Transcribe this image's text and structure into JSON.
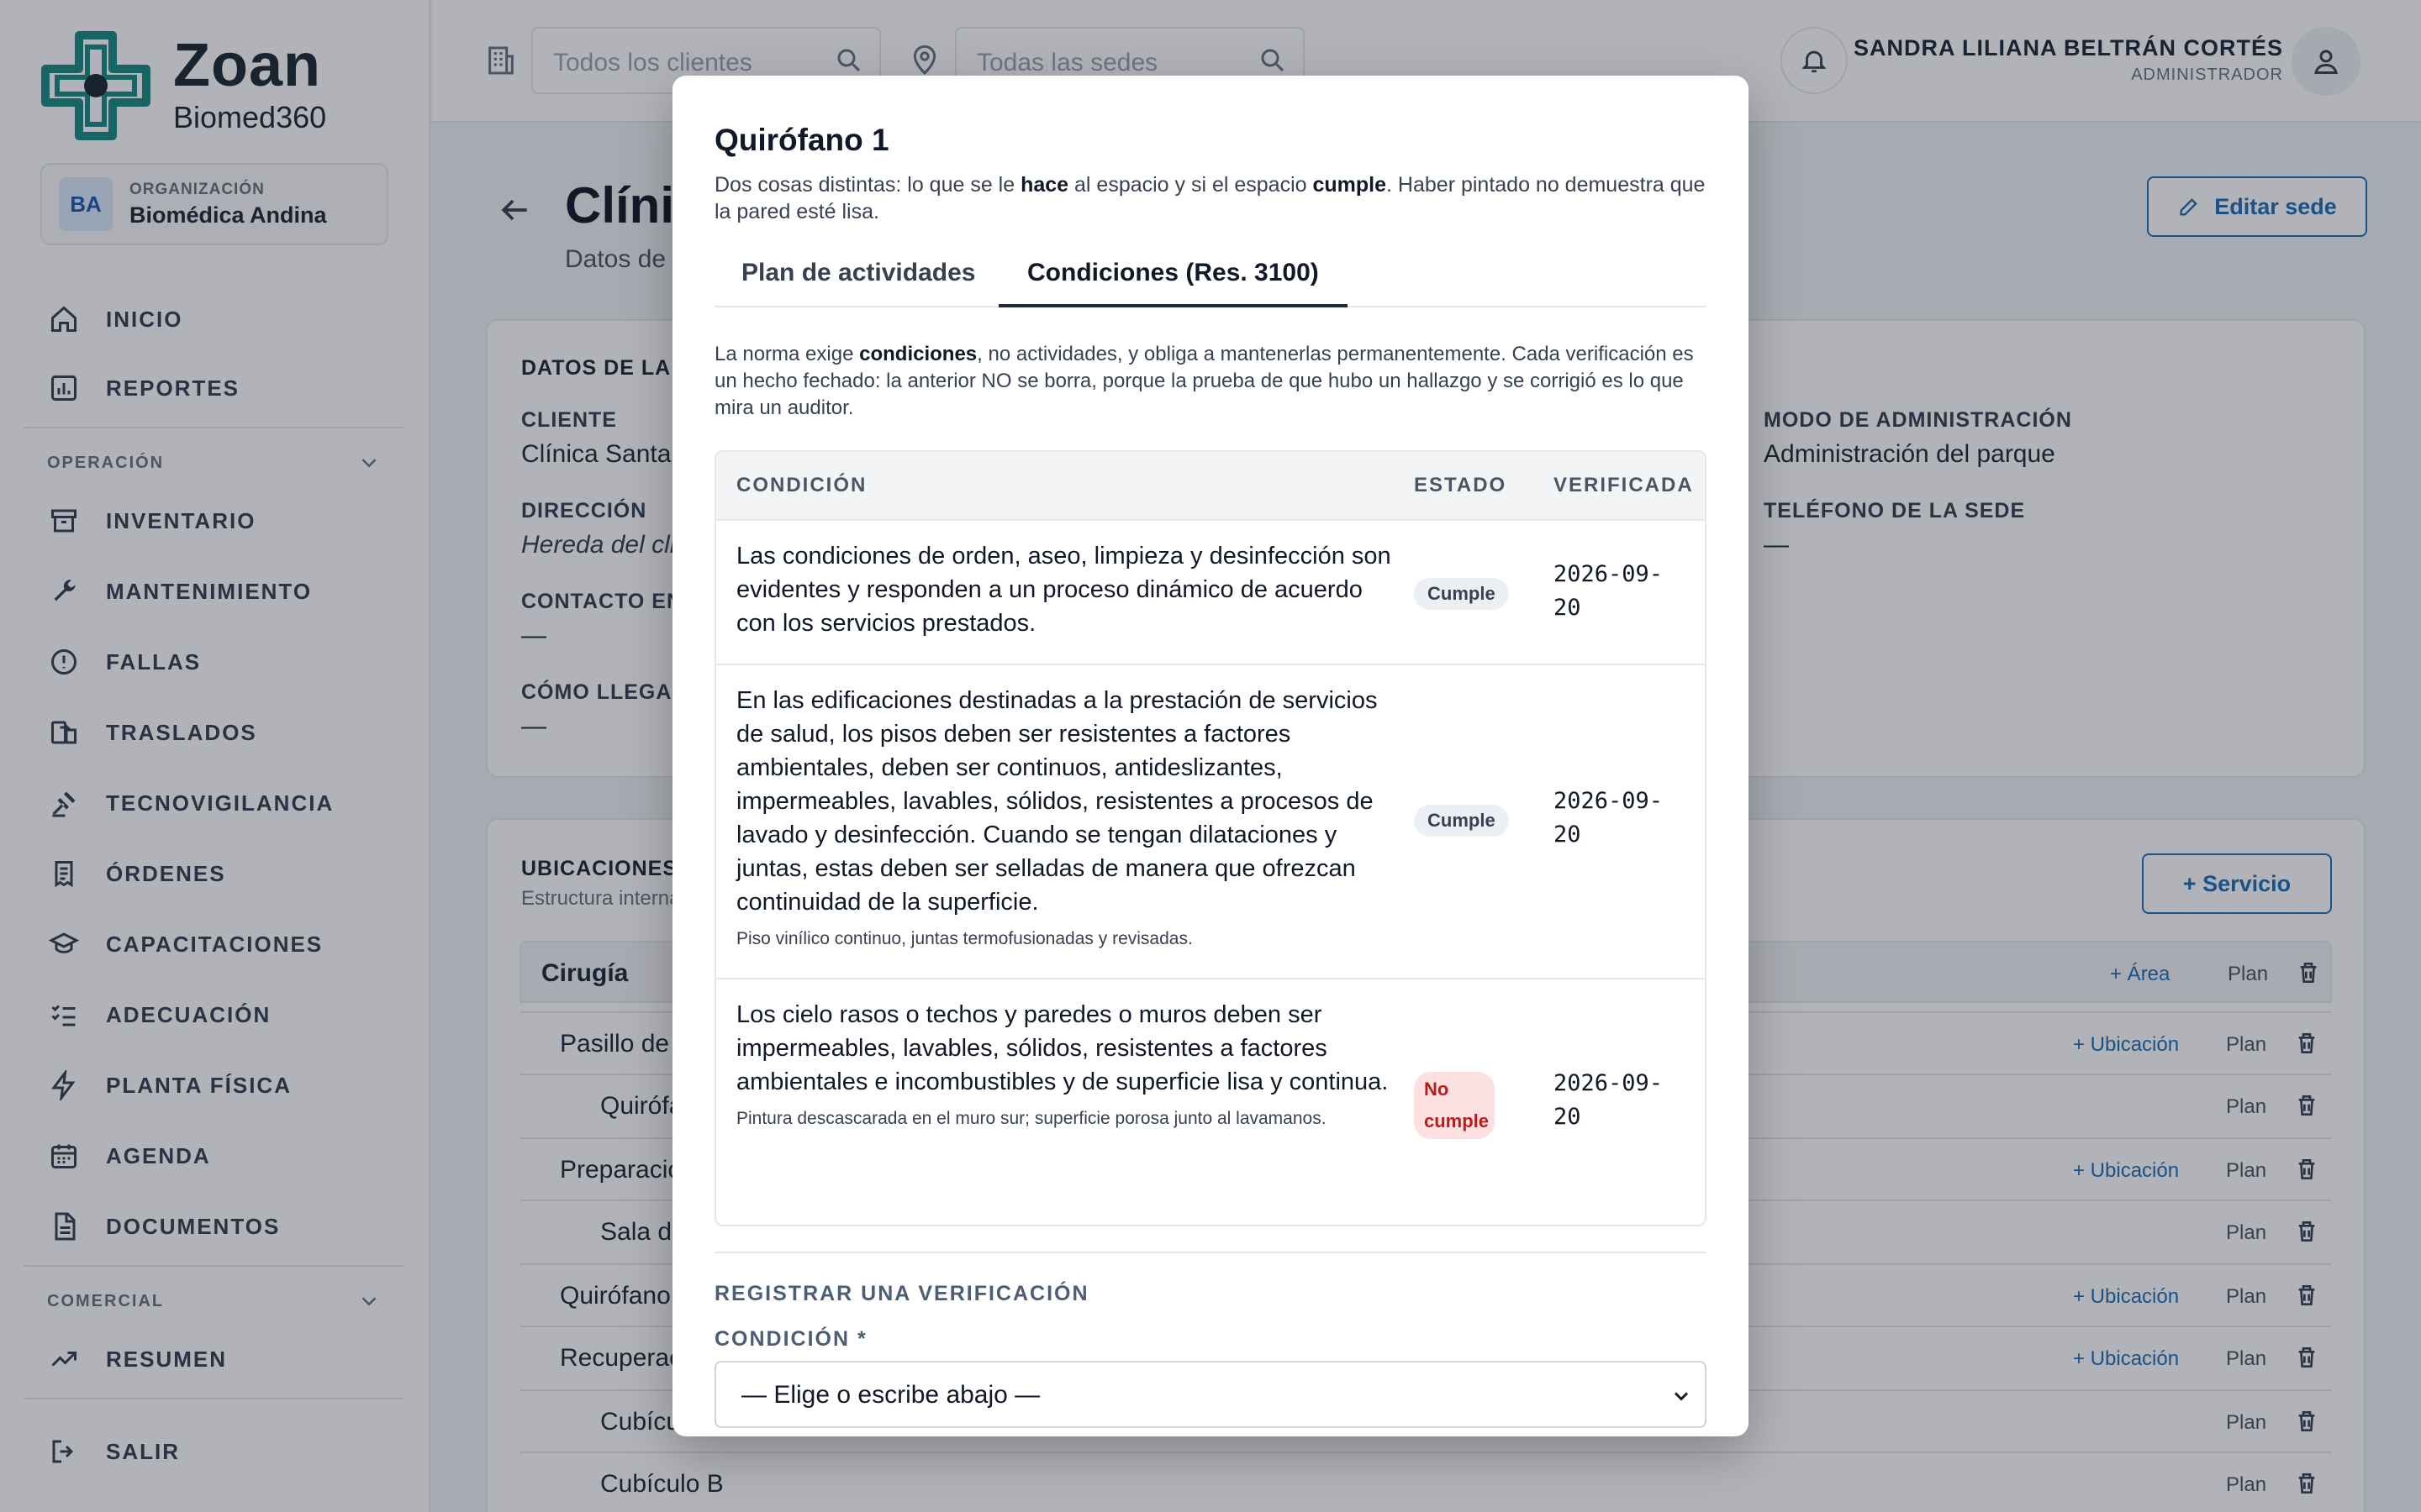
{
  "brand": {
    "name": "Zoan",
    "sub": "Biomed360"
  },
  "org": {
    "label": "ORGANIZACIÓN",
    "name": "Biomédica Andina",
    "initials": "BA"
  },
  "nav": {
    "inicio": "INICIO",
    "reportes": "REPORTES",
    "section_operacion": "OPERACIÓN",
    "inventario": "INVENTARIO",
    "mantenimiento": "MANTENIMIENTO",
    "fallas": "FALLAS",
    "traslados": "TRASLADOS",
    "tecnovigilancia": "TECNOVIGILANCIA",
    "ordenes": "ÓRDENES",
    "capacitaciones": "CAPACITACIONES",
    "adecuacion": "ADECUACIÓN",
    "planta": "PLANTA FÍSICA",
    "agenda": "AGENDA",
    "documentos": "DOCUMENTOS",
    "section_comercial": "COMERCIAL",
    "resumen": "RESUMEN",
    "salir": "SALIR"
  },
  "topbar": {
    "clients_placeholder": "Todos los clientes",
    "sites_placeholder": "Todas las sedes",
    "user_name": "SANDRA LILIANA BELTRÁN CORTÉS",
    "user_role": "ADMINISTRADOR"
  },
  "page": {
    "title": "Clínic",
    "subtitle": "Datos de l",
    "edit_button": "Editar sede",
    "data_card_title": "DATOS DE LA S",
    "cliente_label": "CLIENTE",
    "cliente_value": "Clínica Santa",
    "direccion_label": "DIRECCIÓN",
    "direccion_value": "Hereda del cli",
    "contacto_label": "CONTACTO EN",
    "contacto_value": "—",
    "como_label": "CÓMO LLEGAR",
    "como_value": "—",
    "modo_label": "MODO DE ADMINISTRACIÓN",
    "modo_value": "Administración del parque",
    "telefono_label": "TELÉFONO DE LA SEDE",
    "telefono_value": "—",
    "ubicaciones_title": "UBICACIONES",
    "ubicaciones_sub": "Estructura interna",
    "servicio_button": "+ Servicio"
  },
  "locations": [
    {
      "name": "Cirugía",
      "add": "+ Área",
      "plan": "Plan"
    },
    {
      "name": "Pasillo de",
      "add": "+ Ubicación",
      "plan": "Plan"
    },
    {
      "name": "Quirófa",
      "add": "",
      "plan": "Plan"
    },
    {
      "name": "Preparació",
      "add": "+ Ubicación",
      "plan": "Plan"
    },
    {
      "name": "Sala de",
      "add": "",
      "plan": "Plan"
    },
    {
      "name": "Quirófano",
      "add": "+ Ubicación",
      "plan": "Plan"
    },
    {
      "name": "Recuperac",
      "add": "+ Ubicación",
      "plan": "Plan"
    },
    {
      "name": "Cubícu",
      "add": "",
      "plan": "Plan"
    },
    {
      "name": "Cubículo B",
      "add": "",
      "plan": "Plan"
    }
  ],
  "modal": {
    "title": "Quirófano 1",
    "desc_1": "Dos cosas distintas: lo que se le ",
    "desc_b1": "hace",
    "desc_2": " al espacio y si el espacio ",
    "desc_b2": "cumple",
    "desc_3": ". Haber pintado no demuestra que la pared esté lisa.",
    "tab_plan": "Plan de actividades",
    "tab_conditions": "Condiciones (Res. 3100)",
    "note_1": "La norma exige ",
    "note_b": "condiciones",
    "note_2": ", no actividades, y obliga a mantenerlas permanentemente. Cada verificación es un hecho fechado: la anterior NO se borra, porque la prueba de que hubo un hallazgo y se corrigió es lo que mira un auditor.",
    "th_condition": "CONDICIÓN",
    "th_status": "ESTADO",
    "th_verified": "VERIFICADA",
    "rows": [
      {
        "condition": "Las condiciones de orden, aseo, limpieza y desinfección son evidentes y responden a un proceso dinámico de acuerdo con los servicios prestados.",
        "note": "",
        "status": "Cumple",
        "date": "2026-09-20"
      },
      {
        "condition": "En las edificaciones destinadas a la prestación de servicios de salud, los pisos deben ser resistentes a factores ambientales, deben ser continuos, antideslizantes, impermeables, lavables, sólidos, resistentes a procesos de lavado y desinfección. Cuando se tengan dilataciones y juntas, estas deben ser selladas de manera que ofrezcan continuidad de la superficie.",
        "note": "Piso vinílico continuo, juntas termofusionadas y revisadas.",
        "status": "Cumple",
        "date": "2026-09-20"
      },
      {
        "condition": "Los cielo rasos o techos y paredes o muros deben ser impermeables, lavables, sólidos, resistentes a factores ambientales e incombustibles y de superficie lisa y continua.",
        "note": "Pintura descascarada en el muro sur; superficie porosa junto al lavamanos.",
        "status": "No cumple",
        "date": "2026-09-20"
      }
    ],
    "register_title": "REGISTRAR UNA VERIFICACIÓN",
    "condition_label": "CONDICIÓN *",
    "select_value": "— Elige o escribe abajo —"
  },
  "colors": {
    "accent": "#1e6fb8",
    "brand": "#1a8a84",
    "danger": "#b91c1c"
  }
}
